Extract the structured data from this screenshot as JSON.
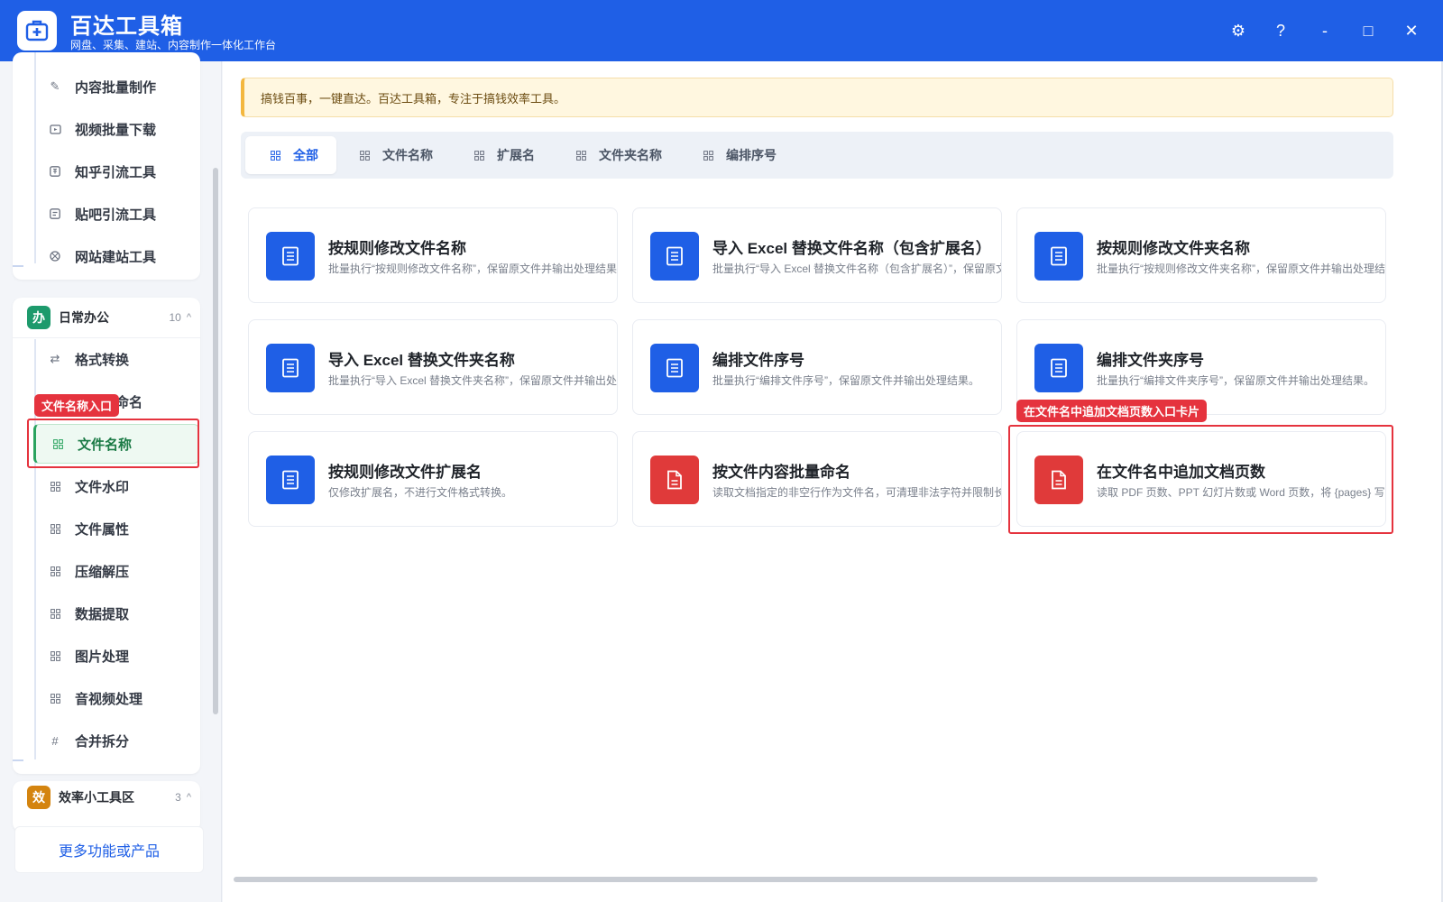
{
  "app": {
    "title": "百达工具箱",
    "subtitle": "网盘、采集、建站、内容制作一体化工作台",
    "brand_color": "#1f5fe6"
  },
  "window_controls": {
    "settings_icon": "⚙",
    "help": "?",
    "minimize": "-",
    "maximize": "□",
    "close": "✕"
  },
  "sidebar": {
    "top_items": [
      {
        "label": "内容批量制作",
        "icon": "pen-icon"
      },
      {
        "label": "视频批量下载",
        "icon": "video-icon"
      },
      {
        "label": "知乎引流工具",
        "icon": "zhihu-icon"
      },
      {
        "label": "贴吧引流工具",
        "icon": "tieba-icon"
      },
      {
        "label": "网站建站工具",
        "icon": "web-icon"
      }
    ],
    "group_office": {
      "badge": "办",
      "name": "日常办公",
      "count": "10",
      "chevron": "^",
      "color": "#1d9a6c",
      "items": [
        {
          "label": "格式转换",
          "icon": "⇄"
        },
        {
          "label": "文件重命名",
          "icon": "grid"
        },
        {
          "label": "文件名称",
          "icon": "grid"
        },
        {
          "label": "文件水印",
          "icon": "grid"
        },
        {
          "label": "文件属性",
          "icon": "grid"
        },
        {
          "label": "压缩解压",
          "icon": "grid"
        },
        {
          "label": "数据提取",
          "icon": "grid"
        },
        {
          "label": "图片处理",
          "icon": "grid"
        },
        {
          "label": "音视频处理",
          "icon": "grid"
        },
        {
          "label": "合并拆分",
          "icon": "#"
        }
      ]
    },
    "group_efficiency": {
      "badge": "效",
      "name": "效率小工具区",
      "count": "3",
      "chevron": "^",
      "color": "#d4840f"
    },
    "more_button": "更多功能或产品"
  },
  "annotations": {
    "sidebar_tag": "文件名称入口",
    "card_tag": "在文件名中追加文档页数入口卡片"
  },
  "main": {
    "notice": "搞钱百事，一键直达。百达工具箱，专注于搞钱效率工具。",
    "tabs": [
      "全部",
      "文件名称",
      "扩展名",
      "文件夹名称",
      "编排序号"
    ],
    "cards": [
      {
        "title": "按规则修改文件名称",
        "desc": "批量执行“按规则修改文件名称”，保留原文件并输出处理结果。",
        "color": "blue"
      },
      {
        "title": "导入 Excel 替换文件名称（包含扩展名）",
        "desc": "批量执行“导入 Excel 替换文件名称（包含扩展名）”，保留原文件并输出处理结果。",
        "color": "blue"
      },
      {
        "title": "按规则修改文件夹名称",
        "desc": "批量执行“按规则修改文件夹名称”，保留原文件并输出处理结果。",
        "color": "blue"
      },
      {
        "title": "导入 Excel 替换文件夹名称",
        "desc": "批量执行“导入 Excel 替换文件夹名称”，保留原文件并输出处理结果。",
        "color": "blue"
      },
      {
        "title": "编排文件序号",
        "desc": "批量执行“编排文件序号”，保留原文件并输出处理结果。",
        "color": "blue"
      },
      {
        "title": "编排文件夹序号",
        "desc": "批量执行“编排文件夹序号”，保留原文件并输出处理结果。",
        "color": "blue"
      },
      {
        "title": "按规则修改文件扩展名",
        "desc": "仅修改扩展名，不进行文件格式转换。",
        "color": "blue"
      },
      {
        "title": "按文件内容批量命名",
        "desc": "读取文档指定的非空行作为文件名，可清理非法字符并限制长度。",
        "color": "red"
      },
      {
        "title": "在文件名中追加文档页数",
        "desc": "读取 PDF 页数、PPT 幻灯片数或 Word 页数，将 {pages} 写入命名规则。",
        "color": "red"
      }
    ]
  },
  "colors": {
    "card_blue": "#1f5fe6",
    "card_red": "#e03a3a",
    "annotation_red": "#e5333e",
    "active_green": "#2aa35f"
  }
}
